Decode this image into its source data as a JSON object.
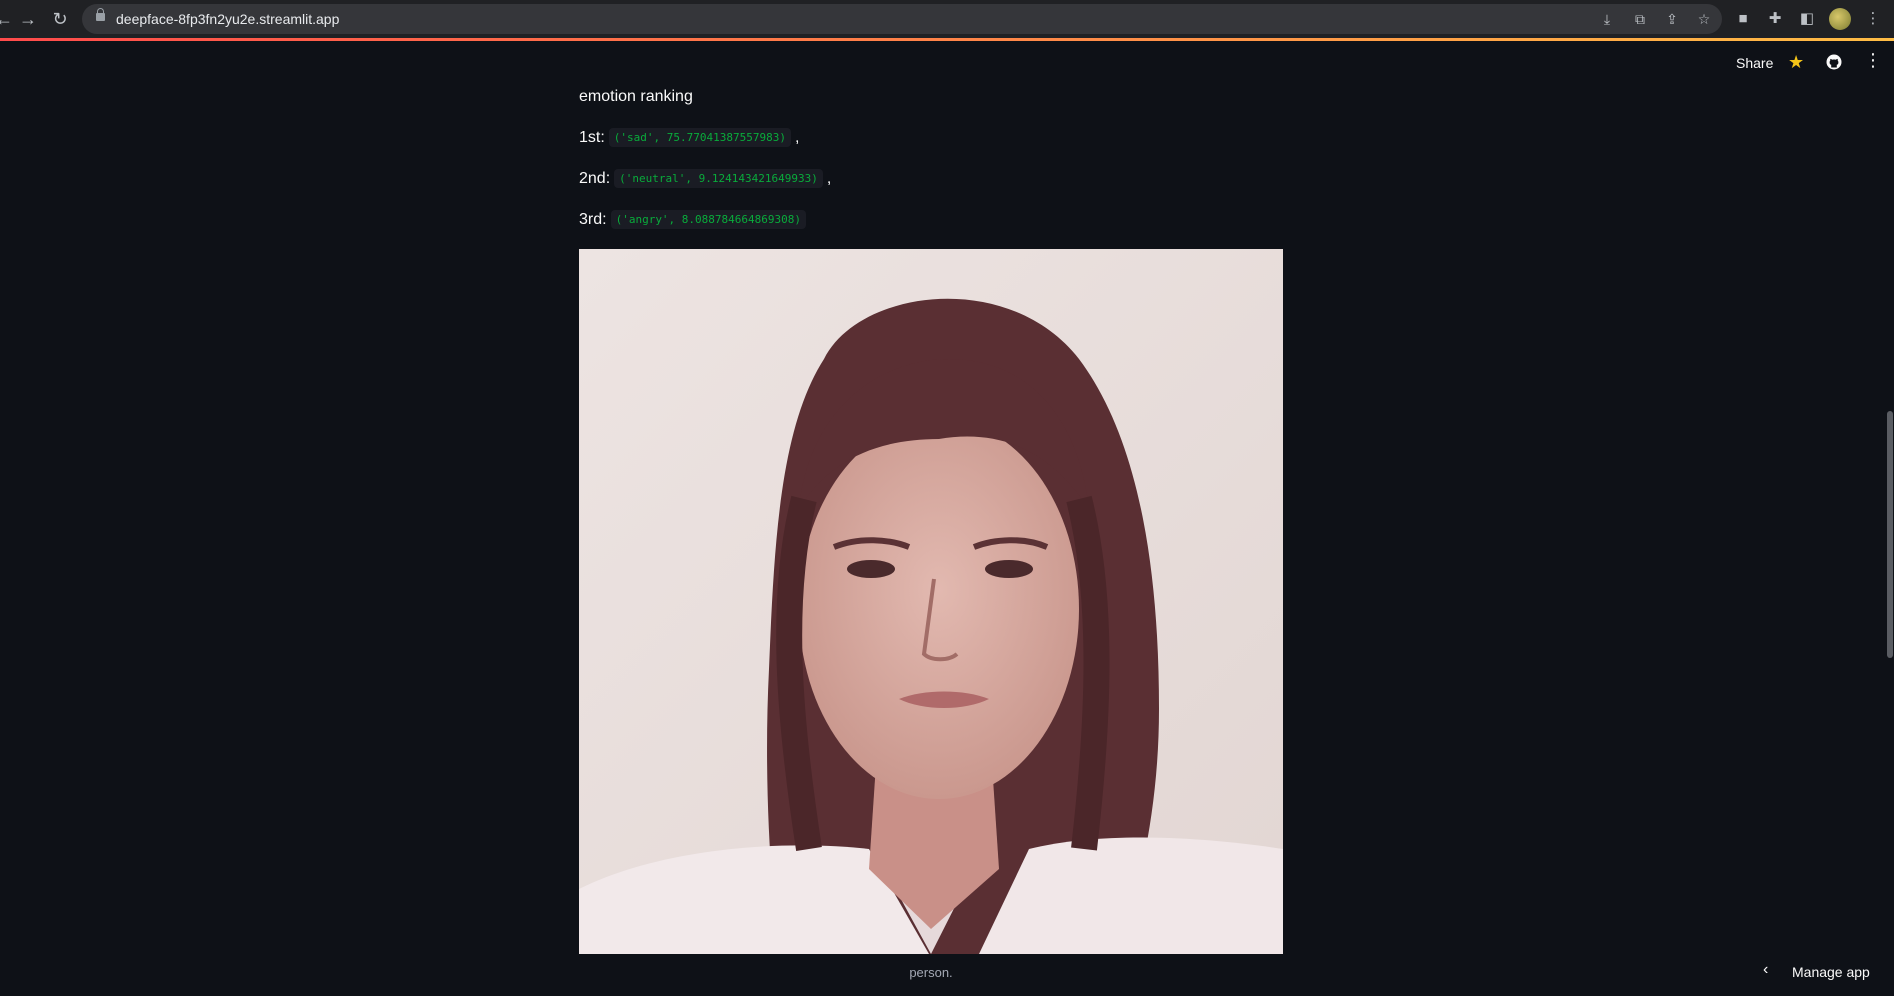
{
  "browser": {
    "url": "deepface-8fp3fn2yu2e.streamlit.app",
    "back_icon": "back-arrow-icon",
    "forward_icon": "forward-arrow-icon",
    "reload_icon": "reload-icon"
  },
  "header": {
    "share_label": "Share"
  },
  "main": {
    "heading": "emotion ranking",
    "rankings": [
      {
        "label": "1st:",
        "value": "('sad', 75.77041387557983)",
        "suffix": ","
      },
      {
        "label": "2nd:",
        "value": "('neutral', 9.124143421649933)",
        "suffix": ","
      },
      {
        "label": "3rd:",
        "value": "('angry', 8.088784664869308)",
        "suffix": ""
      }
    ],
    "caption": "person."
  },
  "footer": {
    "manage_label": "Manage app"
  },
  "colors": {
    "background": "#0e1117",
    "code_text": "#09ab3b",
    "accent_star": "#f5c518"
  }
}
